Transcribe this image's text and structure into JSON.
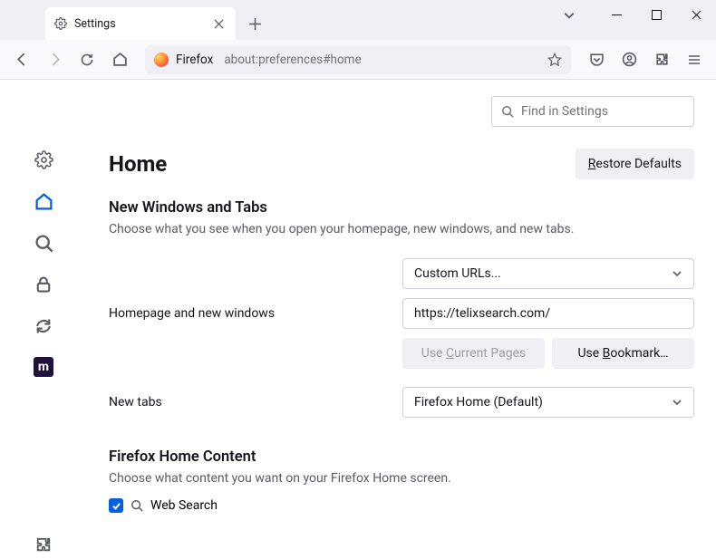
{
  "titlebar": {
    "tab_title": "Settings"
  },
  "toolbar": {
    "firefox_label": "Firefox",
    "url": "about:preferences#home"
  },
  "search": {
    "placeholder": "Find in Settings"
  },
  "page": {
    "title": "Home",
    "restore_label": "estore Defaults",
    "restore_u": "R"
  },
  "nwt": {
    "heading": "New Windows and Tabs",
    "desc": "Choose what you see when you open your homepage, new windows, and new tabs.",
    "homepage_label": "Homepage and new windows",
    "homepage_select": "Custom URLs...",
    "homepage_value": "https://telixsearch.com/",
    "use_current_pre": "Use ",
    "use_current_u": "C",
    "use_current_post": "urrent Pages",
    "use_bookmark_pre": "Use ",
    "use_bookmark_u": "B",
    "use_bookmark_post": "ookmark…",
    "newtabs_label": "New tabs",
    "newtabs_select": "Firefox Home (Default)"
  },
  "fhc": {
    "heading": "Firefox Home Content",
    "desc": "Choose what content you want on your Firefox Home screen.",
    "websearch": "Web Search"
  },
  "sidebar": {
    "moz": "m"
  }
}
